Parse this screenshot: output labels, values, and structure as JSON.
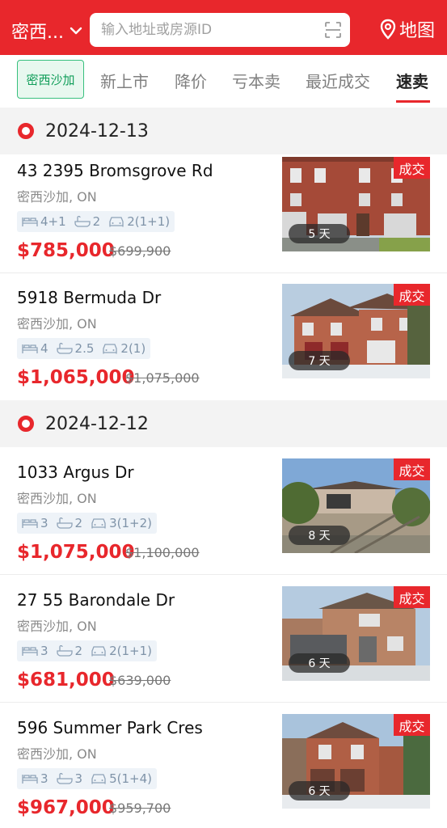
{
  "header": {
    "city_label": "密西...",
    "search_placeholder": "输入地址或房源ID",
    "map_label": "地图",
    "brand_color": "#e8272c"
  },
  "tabs": {
    "chip_label": "密西沙加",
    "items": [
      {
        "label": "新上市"
      },
      {
        "label": "降价"
      },
      {
        "label": "亏本卖"
      },
      {
        "label": "最近成交"
      },
      {
        "label": "速卖",
        "active": true
      }
    ]
  },
  "groups": [
    {
      "date": "2024-12-13",
      "listings": [
        {
          "address": "43 2395 Bromsgrove Rd",
          "city": "密西沙加, ON",
          "beds": "4+1",
          "baths": "2",
          "parking": "2(1+1)",
          "price": "$785,000",
          "old_price": "$699,900",
          "tag": "成交",
          "days": "5 天"
        },
        {
          "address": "5918 Bermuda Dr",
          "city": "密西沙加, ON",
          "beds": "4",
          "baths": "2.5",
          "parking": "2(1)",
          "price": "$1,065,000",
          "old_price": "$1,075,000",
          "tag": "成交",
          "days": "7 天"
        }
      ]
    },
    {
      "date": "2024-12-12",
      "listings": [
        {
          "address": "1033 Argus Dr",
          "city": "密西沙加, ON",
          "beds": "3",
          "baths": "2",
          "parking": "3(1+2)",
          "price": "$1,075,000",
          "old_price": "$1,100,000",
          "tag": "成交",
          "days": "8 天"
        },
        {
          "address": "27 55 Barondale Dr",
          "city": "密西沙加, ON",
          "beds": "3",
          "baths": "2",
          "parking": "2(1+1)",
          "price": "$681,000",
          "old_price": "$639,000",
          "tag": "成交",
          "days": "6 天"
        },
        {
          "address": "596 Summer Park Cres",
          "city": "密西沙加, ON",
          "beds": "3",
          "baths": "3",
          "parking": "5(1+4)",
          "price": "$967,000",
          "old_price": "$959,700",
          "tag": "成交",
          "days": "6 天"
        }
      ]
    }
  ]
}
